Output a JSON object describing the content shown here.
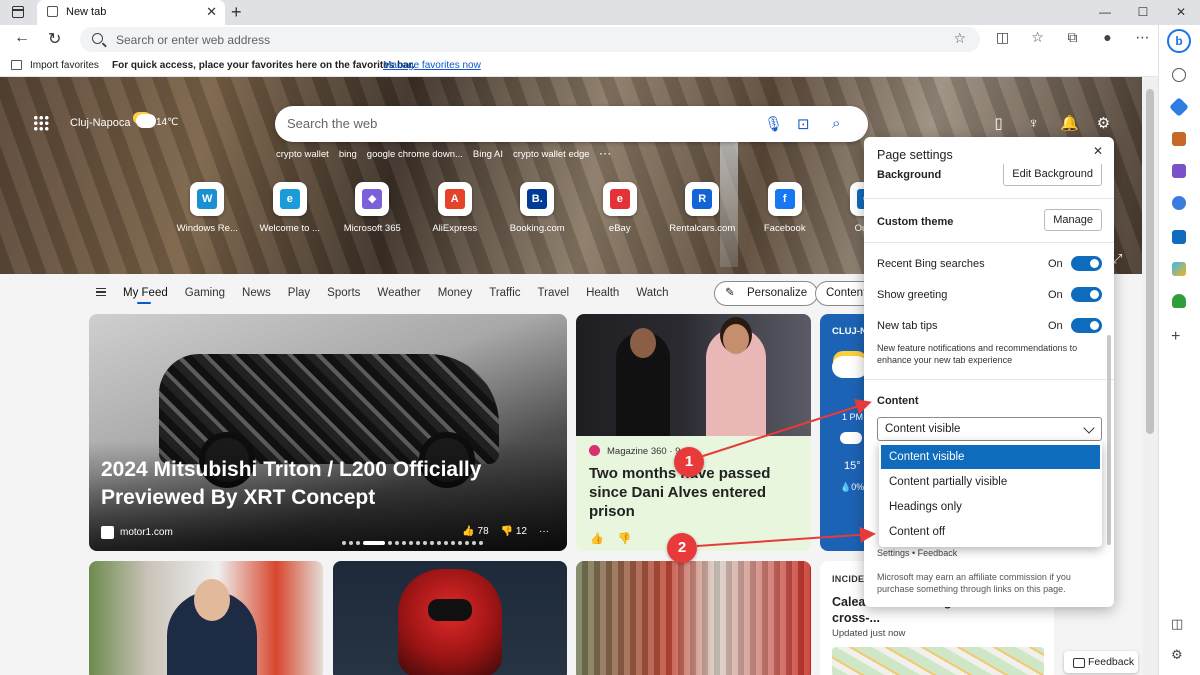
{
  "browser": {
    "tab_title": "New tab",
    "tab_close": "✕",
    "new_tab": "+",
    "window_controls": [
      "—",
      "☐",
      "✕"
    ],
    "address_placeholder": "Search or enter web address",
    "toolbar_icons": [
      "split-screen-icon",
      "favorites-icon",
      "collections-icon",
      "profile-icon",
      "more-icon"
    ]
  },
  "favorites_bar": {
    "import_label": "Import favorites",
    "hint": "For quick access, place your favorites here on the favorites bar.",
    "manage_link": "Manage favorites now"
  },
  "hero": {
    "city": "Cluj-Napoca",
    "temperature": "14℃",
    "search_placeholder": "Search the web",
    "suggestions": [
      "crypto wallet",
      "bing",
      "google chrome down...",
      "Bing AI",
      "crypto wallet edge"
    ],
    "more": "···"
  },
  "quick_links": [
    {
      "label": "Windows Re...",
      "glyph": "W",
      "color": "#1a8fd1"
    },
    {
      "label": "Welcome to ...",
      "glyph": "e",
      "color": "#1b9bd9"
    },
    {
      "label": "Microsoft 365",
      "glyph": "◆",
      "color": "#7b61d9"
    },
    {
      "label": "AliExpress",
      "glyph": "A",
      "color": "#e4432a"
    },
    {
      "label": "Booking.com",
      "glyph": "B.",
      "color": "#003b95"
    },
    {
      "label": "eBay",
      "glyph": "e",
      "color": "#e53238"
    },
    {
      "label": "Rentalcars.com",
      "glyph": "R",
      "color": "#1163d6"
    },
    {
      "label": "Facebook",
      "glyph": "f",
      "color": "#1877f2"
    },
    {
      "label": "Outl...",
      "glyph": "O",
      "color": "#0f6cbd"
    }
  ],
  "feed_nav": {
    "tabs": [
      "My Feed",
      "Gaming",
      "News",
      "Play",
      "Sports",
      "Weather",
      "Money",
      "Traffic",
      "Travel",
      "Health",
      "Watch"
    ],
    "personalize": "Personalize",
    "content": "Content"
  },
  "cards": {
    "main_headline": "2024 Mitsubishi Triton / L200 Officially Previewed By XRT Concept",
    "main_source": "motor1.com",
    "main_likes": "78",
    "main_dislikes": "12",
    "card2_publisher": "Magazine 360 · 9...",
    "card2_title": "Two months have passed since Dani Alves entered prison",
    "card3_city": "CLUJ-N...",
    "card3_time": "1 PM",
    "card3_temp": "15°",
    "card3_precip": "💧0%",
    "card7_kicker": "INCIDE...",
    "card7_title": "Calea... Strada Marginasa. between cross-...",
    "card7_updated": "Updated just now"
  },
  "feedback_label": "Feedback",
  "page_settings": {
    "title": "Page settings",
    "background_label": "Background",
    "edit_background": "Edit Background",
    "custom_theme": "Custom theme",
    "manage": "Manage",
    "recent_bing": "Recent Bing searches",
    "show_greeting": "Show greeting",
    "new_tab_tips": "New tab tips",
    "on": "On",
    "tips_desc": "New feature notifications and recommendations to enhance your new tab experience",
    "content_label": "Content",
    "content_value": "Content visible",
    "footer_links": "Settings • Feedback",
    "affiliate": "Microsoft may earn an affiliate commission if you purchase something through links on this page."
  },
  "content_options": [
    "Content visible",
    "Content partially visible",
    "Headings only",
    "Content off"
  ],
  "annotations": [
    "1",
    "2"
  ],
  "colors": {
    "accent": "#0f6cbd",
    "annotation": "#e83a3a"
  }
}
